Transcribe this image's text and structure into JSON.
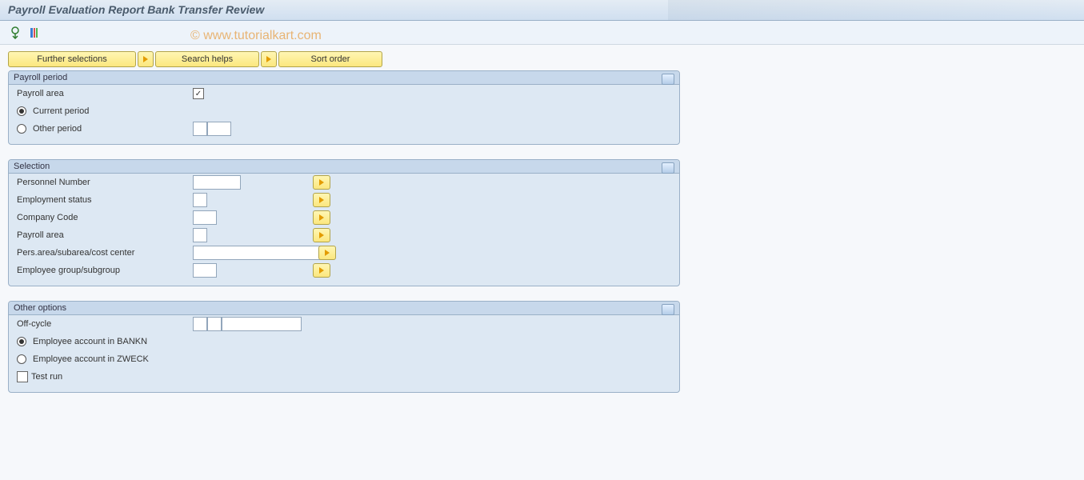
{
  "title": "Payroll Evaluation Report Bank Transfer Review",
  "watermark": "© www.tutorialkart.com",
  "buttons": {
    "further_selections": "Further selections",
    "search_helps": "Search helps",
    "sort_order": "Sort order"
  },
  "groups": {
    "payroll_period": {
      "title": "Payroll period",
      "payroll_area_label": "Payroll area",
      "payroll_area_checked": "✓",
      "current_period": "Current period",
      "other_period": "Other period",
      "other_period_v1": "",
      "other_period_v2": ""
    },
    "selection": {
      "title": "Selection",
      "personnel_number": "Personnel Number",
      "employment_status": "Employment status",
      "company_code": "Company Code",
      "payroll_area": "Payroll area",
      "pers_area": "Pers.area/subarea/cost center",
      "employee_group": "Employee group/subgroup"
    },
    "other_options": {
      "title": "Other options",
      "off_cycle": "Off-cycle",
      "emp_bankn": "Employee account in BANKN",
      "emp_zweck": "Employee account in ZWECK",
      "test_run": "Test run"
    }
  }
}
